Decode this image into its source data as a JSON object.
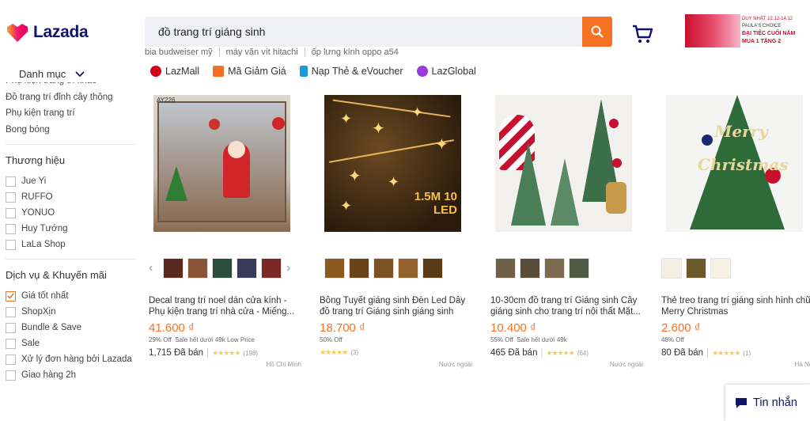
{
  "brand": {
    "name": "Lazada"
  },
  "search": {
    "value": "đồ trang trí giáng sinh",
    "hints": [
      "bia budweiser mỹ",
      "máy vặn vít hitachi",
      "ốp lưng kính oppo a54"
    ]
  },
  "banner": {
    "l1": "DUY NHẤT 12.12-14.12",
    "l2": "PAULA'S CHOICE",
    "l3": "ĐẠI TIỆC CUỐI NĂM",
    "l4": "MUA 1 TẶNG 2"
  },
  "danhmuc": "Danh mục",
  "sidebar": {
    "categories": [
      "Phụ kiện trang trí khác",
      "Đồ trang trí đỉnh cây thông",
      "Phụ kiện trang trí",
      "Bong bóng"
    ],
    "brand_title": "Thương hiệu",
    "brands": [
      "Jue Yi",
      "RUFFO",
      "YONUO",
      "Huy Tướng",
      "LaLa Shop"
    ],
    "service_title": "Dịch vụ & Khuyến mãi",
    "services": [
      "Giá tốt nhất",
      "ShopXịn",
      "Bundle & Save",
      "Sale",
      "Xử lý đơn hàng bởi Lazada",
      "Giao hàng 2h"
    ],
    "service_checked": [
      true,
      false,
      false,
      false,
      false,
      false
    ]
  },
  "nav": [
    {
      "label": "LazMall",
      "color": "#d0011b"
    },
    {
      "label": "Mã Giảm Giá",
      "color": "#f36f21"
    },
    {
      "label": "Nạp Thẻ & eVoucher",
      "color": "#1a9cd8"
    },
    {
      "label": "LazGlobal",
      "color": "#9b3bd8"
    }
  ],
  "products": [
    {
      "title": "Decal trang trí noel dán cửa kính - Phụ kiện trang trí nhà cửa - Miếng...",
      "price": "41.600 ₫",
      "discount": "29% Off",
      "extra": "Sale hết dưới 49k   Low Price",
      "sold": "1,715 Đã bán",
      "rating_count": "(198)",
      "location": "Hồ Chí Minh",
      "img_label": "AY226"
    },
    {
      "title": "Bông Tuyết giáng sinh Đèn Led Dây đồ trang trí Giáng sinh giáng sinh vu...",
      "price": "18.700 ₫",
      "discount": "50% Off",
      "extra": "",
      "sold": "",
      "rating_count": "(3)",
      "location": "Nước ngoài",
      "img_label": "1.5M 10 LED"
    },
    {
      "title": "10-30cm đồ trang trí Giáng sinh Cây giáng sinh cho trang trí nội thất Mặt...",
      "price": "10.400 ₫",
      "discount": "55% Off",
      "extra": "Sale hết dưới 49k",
      "sold": "465 Đã bán",
      "rating_count": "(64)",
      "location": "Nước ngoài",
      "img_label": ""
    },
    {
      "title": "Thẻ treo trang trí giáng sinh hình chữ Merry Christmas",
      "price": "2.600 ₫",
      "discount": "48% Off",
      "extra": "",
      "sold": "80 Đã bán",
      "rating_count": "(1)",
      "location": "Hà Nội",
      "img_label": "Merry Christmas"
    }
  ],
  "stars": "★★★★★",
  "chat": {
    "label": "Tin nhắn"
  }
}
